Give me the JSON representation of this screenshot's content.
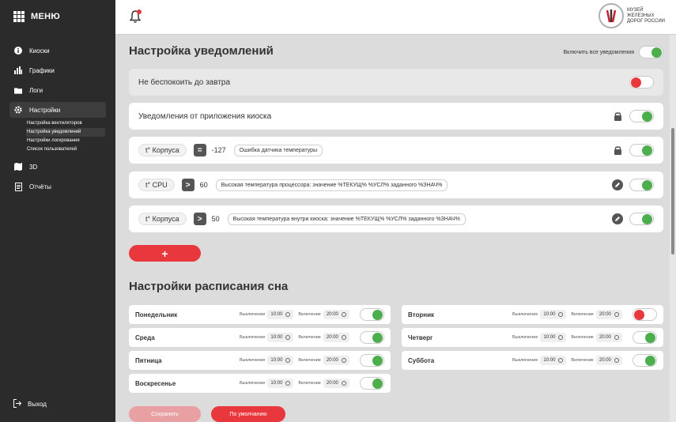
{
  "sidebar": {
    "menu_title": "МЕНЮ",
    "items": [
      {
        "label": "Киоски",
        "icon": "info-icon"
      },
      {
        "label": "Графики",
        "icon": "chart-icon"
      },
      {
        "label": "Логи",
        "icon": "folder-icon"
      },
      {
        "label": "Настройки",
        "icon": "gear-icon"
      },
      {
        "label": "3D",
        "icon": "map-icon"
      },
      {
        "label": "Отчёты",
        "icon": "document-icon"
      }
    ],
    "submenu": [
      "Настройка вентиляторов",
      "Настройка уведомлений",
      "Настройки логирования",
      "Список пользователей"
    ],
    "logout_label": "Выход"
  },
  "logo": {
    "line1": "МУЗЕЙ",
    "line2": "ЖЕЛЕЗНЫХ",
    "line3": "ДОРОГ РОССИИ"
  },
  "notifications": {
    "title": "Настройка уведомлений",
    "enable_all_label": "Включить все уведомления",
    "enable_all_on": true,
    "rows": [
      {
        "label": "Не беспокоить до завтра",
        "on": false
      },
      {
        "label": "Уведомления от приложения киоска",
        "on": true,
        "locked": true
      }
    ],
    "rules": [
      {
        "sensor": "t° Корпуса",
        "op": "=",
        "value": "-127",
        "message": "Ошибка датчика температуры",
        "locked": true,
        "on": true
      },
      {
        "sensor": "t° CPU",
        "op": ">",
        "value": "60",
        "message": "Высокая температура процессора: значение %ТЕКУЩ% %УСЛ% заданного %ЗНАЧ%",
        "locked": false,
        "on": true
      },
      {
        "sensor": "t° Корпуса",
        "op": ">",
        "value": "50",
        "message": "Высокая температура внутри киоска: значение %ТЕКУЩ% %УСЛ% заданного %ЗНАЧ%",
        "locked": false,
        "on": true
      }
    ],
    "add_label": "+"
  },
  "sleep": {
    "title": "Настройки расписания сна",
    "off_label": "Выключение",
    "on_label": "Включение",
    "days": [
      {
        "name": "Понедельник",
        "off": "10:00",
        "on": "20:00",
        "enabled": true
      },
      {
        "name": "Вторник",
        "off": "10:00",
        "on": "20:00",
        "enabled": false
      },
      {
        "name": "Среда",
        "off": "10:00",
        "on": "20:00",
        "enabled": true
      },
      {
        "name": "Четверг",
        "off": "10:00",
        "on": "20:00",
        "enabled": true
      },
      {
        "name": "Пятница",
        "off": "10:00",
        "on": "20:00",
        "enabled": true
      },
      {
        "name": "Суббота",
        "off": "10:00",
        "on": "20:00",
        "enabled": true
      },
      {
        "name": "Воскресенье",
        "off": "10:00",
        "on": "20:00",
        "enabled": true
      }
    ],
    "save_label": "Сохранить",
    "defaults_label": "По умолчанию"
  },
  "colors": {
    "accent": "#e8383d",
    "toggle_on": "#4cae4c",
    "sidebar_bg": "#2b2b2b"
  }
}
